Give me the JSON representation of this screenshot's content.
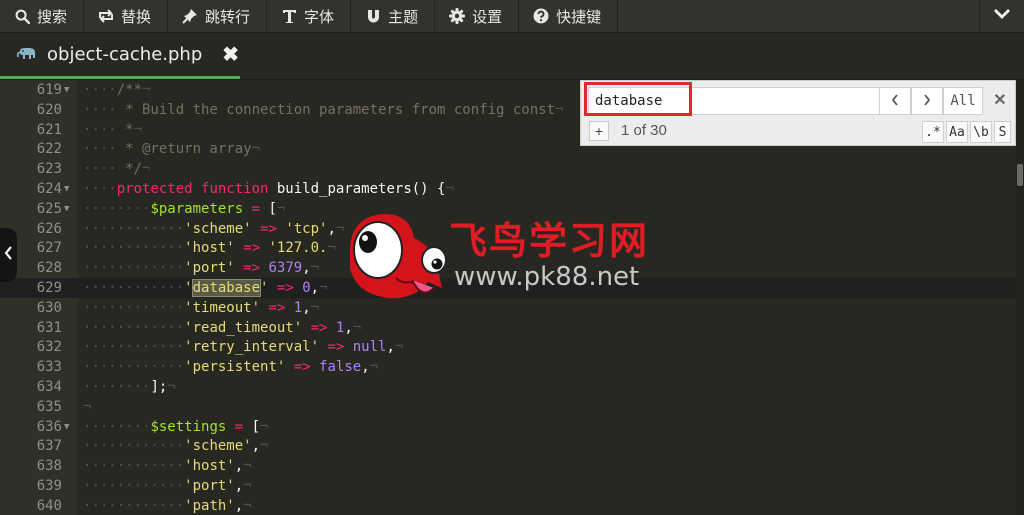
{
  "toolbar": {
    "search": "搜索",
    "replace": "替换",
    "goto": "跳转行",
    "font": "字体",
    "theme": "主题",
    "settings": "设置",
    "shortcuts": "快捷键"
  },
  "tab": {
    "filename": "object-cache.php"
  },
  "search": {
    "query": "database",
    "all_label": "All",
    "plus_label": "+",
    "count": "1 of 30",
    "regex_label": ".*",
    "case_label": "Aa",
    "word_label": "\\b",
    "selection_label": "S"
  },
  "watermark": {
    "title": "飞鸟学习网",
    "url": "www.pk88.net"
  },
  "colors": {
    "accent": "#4caf50",
    "highlight_box": "#e0282e",
    "editor_bg": "#272822"
  },
  "code": {
    "lines": [
      {
        "n": "619",
        "fold": true,
        "indent": 1,
        "segs": [
          [
            "c-cmt",
            "/**"
          ]
        ]
      },
      {
        "n": "620",
        "fold": false,
        "indent": 1,
        "segs": [
          [
            "c-cmt",
            " * Build the connection parameters from config const"
          ]
        ]
      },
      {
        "n": "621",
        "fold": false,
        "indent": 1,
        "segs": [
          [
            "c-cmt",
            " *"
          ]
        ]
      },
      {
        "n": "622",
        "fold": false,
        "indent": 1,
        "segs": [
          [
            "c-cmt",
            " * @return array"
          ]
        ]
      },
      {
        "n": "623",
        "fold": false,
        "indent": 1,
        "segs": [
          [
            "c-cmt",
            " */"
          ]
        ]
      },
      {
        "n": "624",
        "fold": true,
        "indent": 1,
        "segs": [
          [
            "c-kw",
            "protected"
          ],
          [
            "c-pl",
            " "
          ],
          [
            "c-kw",
            "function"
          ],
          [
            "c-pl",
            " build_parameters() {"
          ]
        ]
      },
      {
        "n": "625",
        "fold": true,
        "indent": 2,
        "segs": [
          [
            "c-var",
            "$parameters"
          ],
          [
            "c-pl",
            " "
          ],
          [
            "c-op",
            "="
          ],
          [
            "c-pl",
            " ["
          ]
        ]
      },
      {
        "n": "626",
        "fold": false,
        "indent": 3,
        "segs": [
          [
            "c-str",
            "'scheme'"
          ],
          [
            "c-pl",
            " "
          ],
          [
            "c-op",
            "=>"
          ],
          [
            "c-pl",
            " "
          ],
          [
            "c-str",
            "'tcp'"
          ],
          [
            "c-pl",
            ","
          ]
        ]
      },
      {
        "n": "627",
        "fold": false,
        "indent": 3,
        "segs": [
          [
            "c-str",
            "'host'"
          ],
          [
            "c-pl",
            " "
          ],
          [
            "c-op",
            "=>"
          ],
          [
            "c-pl",
            " "
          ],
          [
            "c-str",
            "'127.0."
          ]
        ]
      },
      {
        "n": "628",
        "fold": false,
        "indent": 3,
        "segs": [
          [
            "c-str",
            "'port'"
          ],
          [
            "c-pl",
            " "
          ],
          [
            "c-op",
            "=>"
          ],
          [
            "c-pl",
            " "
          ],
          [
            "c-num",
            "6379"
          ],
          [
            "c-pl",
            ","
          ]
        ]
      },
      {
        "n": "629",
        "fold": false,
        "indent": 3,
        "active": true,
        "segs": [
          [
            "c-str",
            "'"
          ],
          [
            "c-str hl",
            "database"
          ],
          [
            "c-str",
            "'"
          ],
          [
            "c-pl",
            " "
          ],
          [
            "c-op",
            "=>"
          ],
          [
            "c-pl",
            " "
          ],
          [
            "c-num",
            "0"
          ],
          [
            "c-pl",
            ","
          ]
        ]
      },
      {
        "n": "630",
        "fold": false,
        "indent": 3,
        "segs": [
          [
            "c-str",
            "'timeout'"
          ],
          [
            "c-pl",
            " "
          ],
          [
            "c-op",
            "=>"
          ],
          [
            "c-pl",
            " "
          ],
          [
            "c-num",
            "1"
          ],
          [
            "c-pl",
            ","
          ]
        ]
      },
      {
        "n": "631",
        "fold": false,
        "indent": 3,
        "segs": [
          [
            "c-str",
            "'read_timeout'"
          ],
          [
            "c-pl",
            " "
          ],
          [
            "c-op",
            "=>"
          ],
          [
            "c-pl",
            " "
          ],
          [
            "c-num",
            "1"
          ],
          [
            "c-pl",
            ","
          ]
        ]
      },
      {
        "n": "632",
        "fold": false,
        "indent": 3,
        "segs": [
          [
            "c-str",
            "'retry_interval'"
          ],
          [
            "c-pl",
            " "
          ],
          [
            "c-op",
            "=>"
          ],
          [
            "c-pl",
            " "
          ],
          [
            "c-num",
            "null"
          ],
          [
            "c-pl",
            ","
          ]
        ]
      },
      {
        "n": "633",
        "fold": false,
        "indent": 3,
        "segs": [
          [
            "c-str",
            "'persistent'"
          ],
          [
            "c-pl",
            " "
          ],
          [
            "c-op",
            "=>"
          ],
          [
            "c-pl",
            " "
          ],
          [
            "c-num",
            "false"
          ],
          [
            "c-pl",
            ","
          ]
        ]
      },
      {
        "n": "634",
        "fold": false,
        "indent": 2,
        "segs": [
          [
            "c-pl",
            "];"
          ]
        ]
      },
      {
        "n": "635",
        "fold": false,
        "indent": 0,
        "segs": []
      },
      {
        "n": "636",
        "fold": true,
        "indent": 2,
        "segs": [
          [
            "c-var",
            "$settings"
          ],
          [
            "c-pl",
            " "
          ],
          [
            "c-op",
            "="
          ],
          [
            "c-pl",
            " ["
          ]
        ]
      },
      {
        "n": "637",
        "fold": false,
        "indent": 3,
        "segs": [
          [
            "c-str",
            "'scheme'"
          ],
          [
            "c-pl",
            ","
          ]
        ]
      },
      {
        "n": "638",
        "fold": false,
        "indent": 3,
        "segs": [
          [
            "c-str",
            "'host'"
          ],
          [
            "c-pl",
            ","
          ]
        ]
      },
      {
        "n": "639",
        "fold": false,
        "indent": 3,
        "segs": [
          [
            "c-str",
            "'port'"
          ],
          [
            "c-pl",
            ","
          ]
        ]
      },
      {
        "n": "640",
        "fold": false,
        "indent": 3,
        "segs": [
          [
            "c-str",
            "'path'"
          ],
          [
            "c-pl",
            ","
          ]
        ]
      }
    ]
  }
}
